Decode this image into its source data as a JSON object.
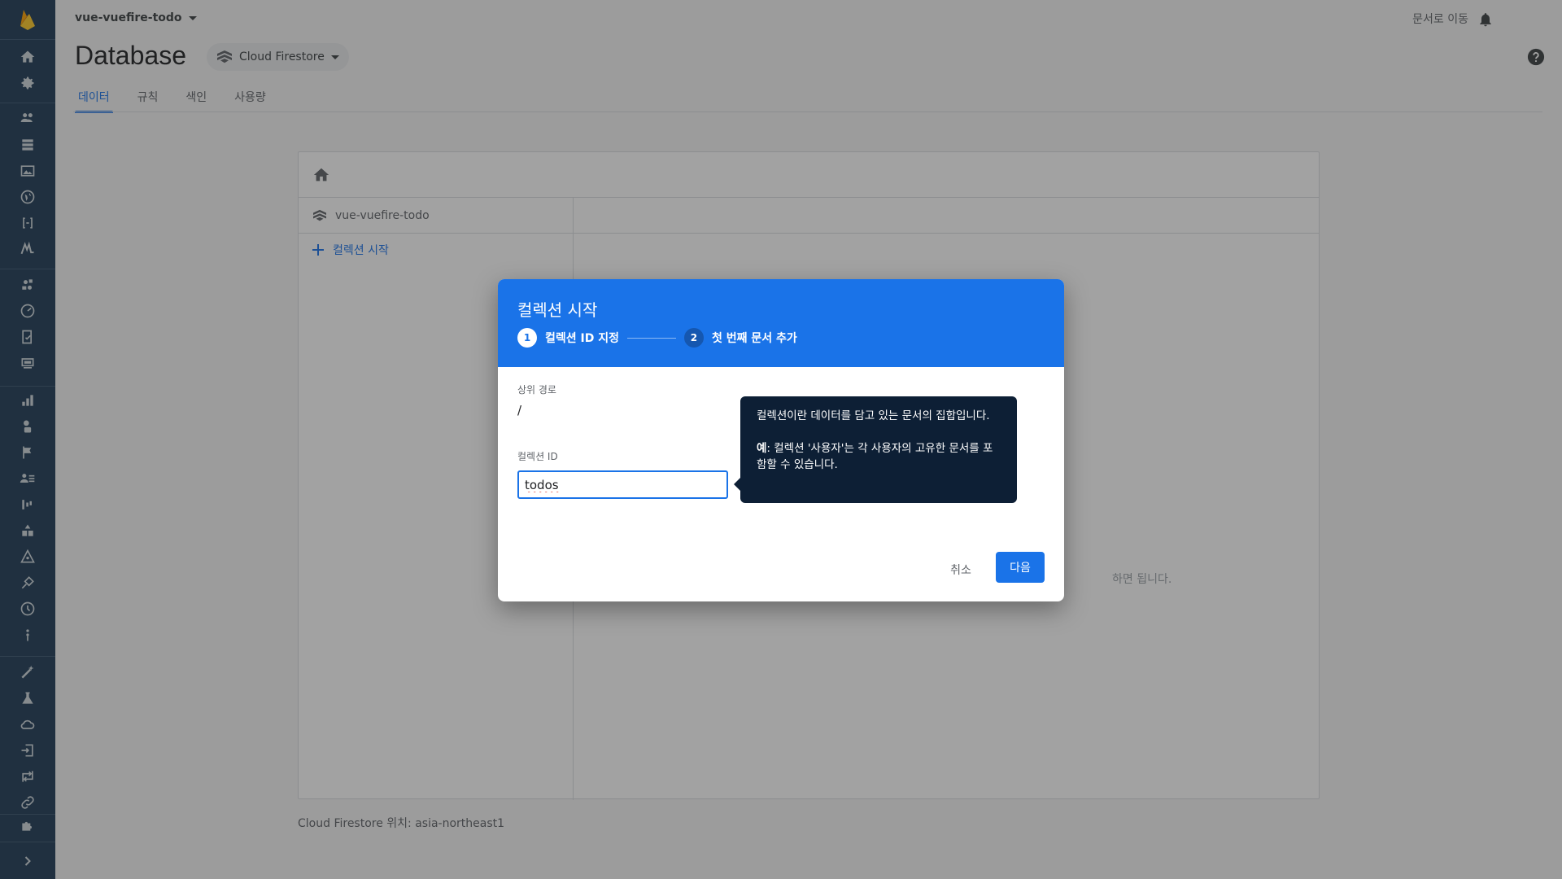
{
  "app": {
    "project_name": "vue-vuefire-todo",
    "docs_link": "문서로 이동",
    "page_title": "Database",
    "product_selector": "Cloud Firestore"
  },
  "tabs": [
    {
      "label": "데이터",
      "active": true
    },
    {
      "label": "규칙",
      "active": false
    },
    {
      "label": "색인",
      "active": false
    },
    {
      "label": "사용량",
      "active": false
    }
  ],
  "sidebar": {
    "icons": [
      "firebase-logo-icon",
      "home-icon",
      "settings-icon",
      "users-icon",
      "database-icon",
      "storage-icon",
      "hosting-icon",
      "functions-icon",
      "ml-kit-icon",
      "crashlytics-icon",
      "performance-icon",
      "test-lab-icon",
      "app-distribution-icon",
      "analytics-icon",
      "predictions-icon",
      "remote-config-icon",
      "audiences-icon",
      "streamview-icon",
      "ab-testing-icon",
      "cloud-messaging-icon",
      "in-app-messaging-icon",
      "dynamic-links-icon",
      "clock-icon",
      "extensions-icon",
      "magic-wand-icon",
      "lab-icon",
      "cloud-icon",
      "export-icon",
      "flow-icon",
      "link-icon",
      "puzzle-icon",
      "expand-icon"
    ]
  },
  "data_panel": {
    "root_collection": "vue-vuefire-todo",
    "start_collection": "컬렉션 시작",
    "hint_fragment": "하면 됩니다.",
    "location": "Cloud Firestore 위치: asia-northeast1"
  },
  "dialog": {
    "title": "컬렉션 시작",
    "steps": [
      {
        "number": "1",
        "label": "컬렉션 ID 지정"
      },
      {
        "number": "2",
        "label": "첫 번째 문서 추가"
      }
    ],
    "parent_path_label": "상위 경로",
    "parent_path_value": "/",
    "collection_id_label": "컬렉션 ID",
    "collection_id_value": "todos",
    "tooltip_line1": "컬렉션이란 데이터를 담고 있는 문서의 집합입니다.",
    "tooltip_example_bold": "예",
    "tooltip_example_rest": ": 컬렉션 '사용자'는 각 사용자의 고유한 문서를 포함할 수 있습니다.",
    "cancel_label": "취소",
    "next_label": "다음"
  },
  "colors": {
    "sidebar_bg": "#1f3b57",
    "accent": "#1a73e8",
    "tooltip_bg": "#0d1f35"
  }
}
